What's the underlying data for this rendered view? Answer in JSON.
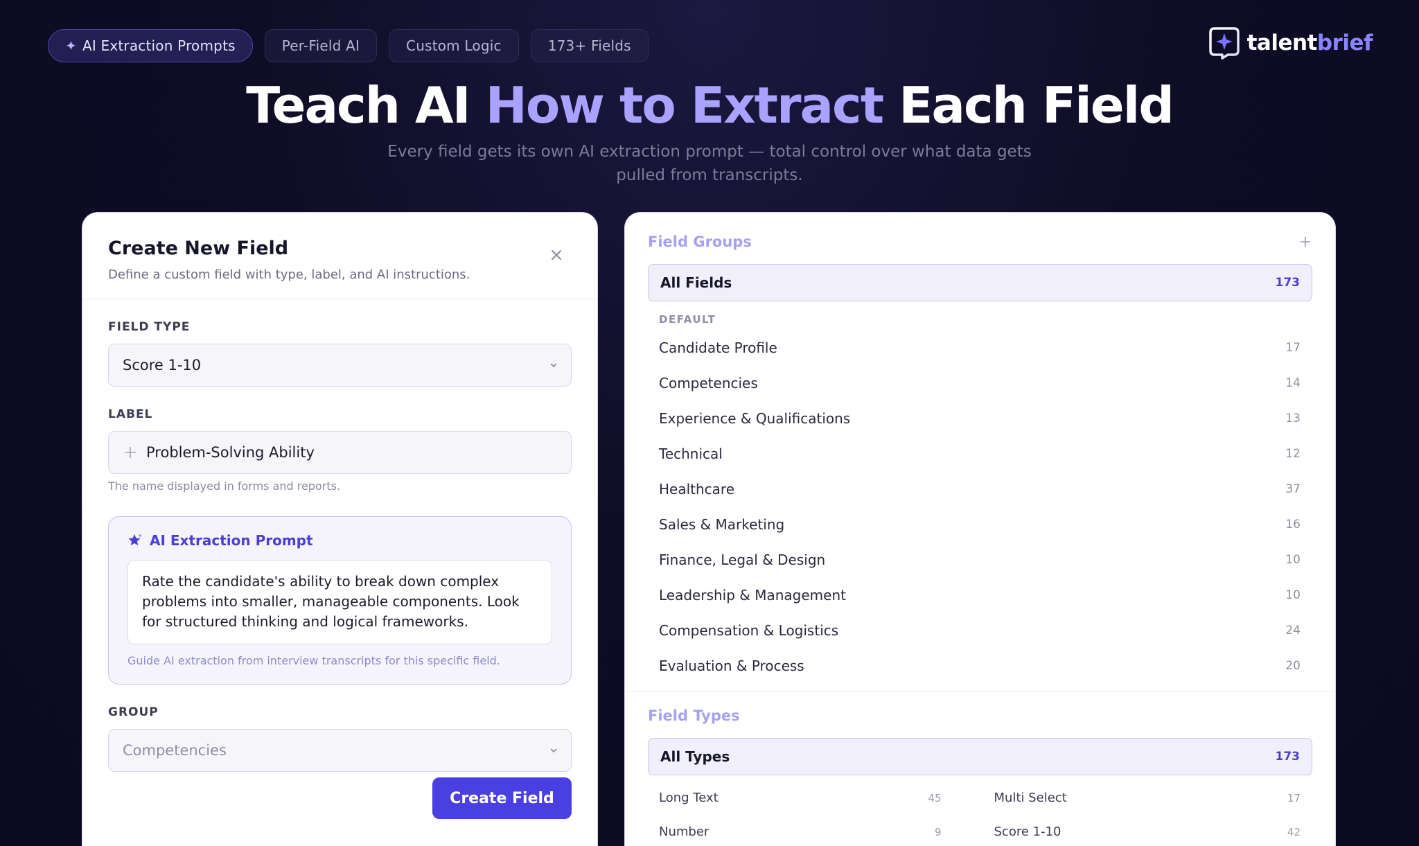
{
  "top_pills": [
    {
      "label": "AI Extraction Prompts",
      "active": true
    },
    {
      "label": "Per-Field AI"
    },
    {
      "label": "Custom Logic"
    },
    {
      "label": "173+ Fields"
    }
  ],
  "brand": {
    "part1": "talent",
    "part2": "brief"
  },
  "hero": {
    "title_pre": "Teach AI ",
    "title_highlight": "How to Extract",
    "title_post": " Each Field",
    "subtitle_line1": "Every field gets its own AI extraction prompt — total control over what data gets",
    "subtitle_line2": "pulled from transcripts."
  },
  "create_field": {
    "title": "Create New Field",
    "subtitle": "Define a custom field with type, label, and AI instructions.",
    "field_type_label": "FIELD TYPE",
    "field_type_value": "Score 1-10",
    "label_label": "LABEL",
    "label_value": "Problem-Solving Ability",
    "label_hint": "The name displayed in forms and reports.",
    "prompt_title": "AI Extraction Prompt",
    "prompt_text": "Rate the candidate's ability to break down complex problems into smaller, manageable components. Look for structured thinking and logical frameworks.",
    "prompt_hint": "Guide AI extraction from interview transcripts for this specific field.",
    "group_label": "GROUP",
    "group_value": "Competencies",
    "submit_label": "Create Field"
  },
  "field_groups": {
    "title": "Field Groups",
    "all_label": "All Fields",
    "all_count": "173",
    "section_label": "DEFAULT",
    "items": [
      {
        "label": "Candidate Profile",
        "count": "17"
      },
      {
        "label": "Competencies",
        "count": "14"
      },
      {
        "label": "Experience & Qualifications",
        "count": "13"
      },
      {
        "label": "Technical",
        "count": "12"
      },
      {
        "label": "Healthcare",
        "count": "37"
      },
      {
        "label": "Sales & Marketing",
        "count": "16"
      },
      {
        "label": "Finance, Legal & Design",
        "count": "10"
      },
      {
        "label": "Leadership & Management",
        "count": "10"
      },
      {
        "label": "Compensation & Logistics",
        "count": "24"
      },
      {
        "label": "Evaluation & Process",
        "count": "20"
      }
    ]
  },
  "field_types": {
    "title": "Field Types",
    "all_label": "All Types",
    "all_count": "173",
    "items": [
      {
        "label": "Long Text",
        "count": "45"
      },
      {
        "label": "Multi Select",
        "count": "17"
      },
      {
        "label": "Number",
        "count": "9"
      },
      {
        "label": "Score 1-10",
        "count": "42"
      }
    ]
  },
  "colors": {
    "accent": "#4a3fe0",
    "highlight": "#a9a2ff",
    "background": "#0f0d26"
  }
}
